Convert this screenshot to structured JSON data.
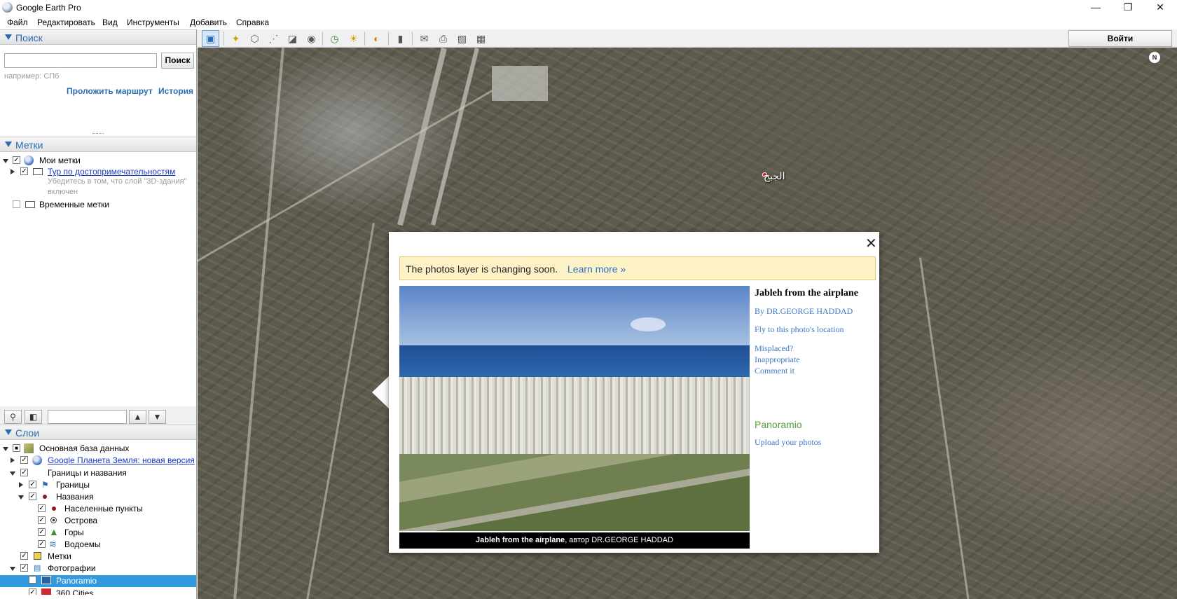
{
  "window": {
    "title": "Google Earth Pro",
    "minimize": "—",
    "maximize": "❐",
    "close": "✕"
  },
  "menu": [
    "Файл",
    "Редактировать",
    "Вид",
    "Инструменты",
    "Добавить",
    "Справка"
  ],
  "search": {
    "header": "Поиск",
    "input_value": "",
    "button": "Поиск",
    "hint": "например: СПб",
    "route_link": "Проложить маршрут",
    "history_link": "История"
  },
  "places": {
    "header": "Метки",
    "items": [
      {
        "label": "Мои метки"
      },
      {
        "label": "Тур по достопримечательностям"
      },
      {
        "label": "Убедитесь в том, что слой \"3D-здания\""
      },
      {
        "label": "включен"
      },
      {
        "label": "Временные метки"
      }
    ]
  },
  "layers": {
    "header": "Слои",
    "filter_value": "",
    "items": [
      {
        "label": "Основная база данных"
      },
      {
        "label": "Google Планета Земля: новая версия"
      },
      {
        "label": "Границы и названия"
      },
      {
        "label": "Границы"
      },
      {
        "label": "Названия"
      },
      {
        "label": "Населенные пункты"
      },
      {
        "label": "Острова"
      },
      {
        "label": "Горы"
      },
      {
        "label": "Водоемы"
      },
      {
        "label": "Метки"
      },
      {
        "label": "Фотографии"
      },
      {
        "label": "Panoramio"
      },
      {
        "label": "360 Cities"
      }
    ]
  },
  "toolbar": {
    "login": "Войти"
  },
  "map": {
    "compass": "N",
    "placemark_label": "الجبح"
  },
  "popup": {
    "close": "✕",
    "notice_text": "The photos layer is changing soon.",
    "notice_link": "Learn more »",
    "photo_caption_title": "Jableh from the airplane",
    "photo_caption_rest": ", автор DR.GEORGE HADDAD",
    "title": "Jableh from the airplane",
    "author_link": "By DR.GEORGE HADDAD",
    "fly_link": "Fly to this photo's location",
    "misplaced_link": "Misplaced?",
    "inappropriate_link": "Inappropriate",
    "comment_link": "Comment it",
    "brand": "Panoramio",
    "upload_link": "Upload your photos"
  },
  "colors": {
    "accent": "#2a6db7",
    "selection": "#3399dd",
    "link": "#3d78c4",
    "notice_bg": "#fdf1c6"
  }
}
